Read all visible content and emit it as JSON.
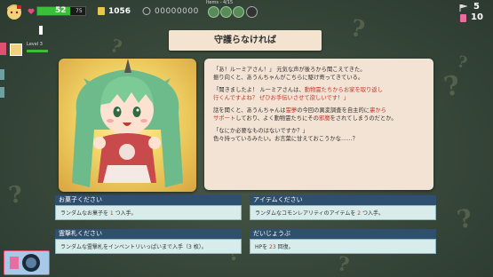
{
  "hud": {
    "hp_value": "52",
    "hp_max": "75",
    "hp_fraction": 0.69,
    "coins": "1056",
    "score": "00000000",
    "items_label": "Items - 4/15",
    "counter_top": "5",
    "counter_bottom": "10",
    "level_label": "Level 3"
  },
  "event": {
    "title": "守護らなければ"
  },
  "dialog": {
    "p1": "「あ！ルーミアさん！」 元気な声が後ろから聞こえてきた。\n振り向くと、あうんちゃんがこちらに駆け寄ってきている。",
    "p2_a": "「聞きましたよ！ ルーミアさんは、",
    "p2_h1": "動物霊たちからお家を取り返し",
    "p2_b": "\n",
    "p2_h2": "行くんですよね？ ぜひお手伝いさせて欲しいです！」",
    "p3_a": "話を聞くと、あうんちゃんは",
    "p3_h1": "霊夢",
    "p3_b": "の今回の異変調査を自主的に",
    "p3_h2": "裏から",
    "p3_c": "\n",
    "p3_h3": "サポート",
    "p3_d": "しており、よく動物霊たちにその",
    "p3_h4": "邪魔",
    "p3_e": "をされてしまうのだとか。",
    "p4": "「なにか必要なものはないですか？」\n色々持っているみたい。お言葉に甘えておこうかな……？"
  },
  "options": [
    {
      "title": "お菓子ください",
      "desc_a": "ランダムなお菓子を ",
      "desc_h": "1",
      "desc_b": " つ入手。"
    },
    {
      "title": "アイテムください",
      "desc_a": "ランダムなコモンレアリティのアイテムを ",
      "desc_h": "2",
      "desc_b": " つ入手。"
    },
    {
      "title": "霊撃札ください",
      "desc_a": "ランダムな霊撃札をインベントリいっぱいまで入手（3 枚）。",
      "desc_h": "",
      "desc_b": ""
    },
    {
      "title": "だいじょうぶ",
      "desc_a": "HPを ",
      "desc_h": "23",
      "desc_b": " 回復。"
    }
  ],
  "colors": {
    "hp_bar": "#3bbf3b",
    "highlight": "#c0392b",
    "option_header": "#2f4f6f",
    "option_body": "#d8ecec"
  }
}
